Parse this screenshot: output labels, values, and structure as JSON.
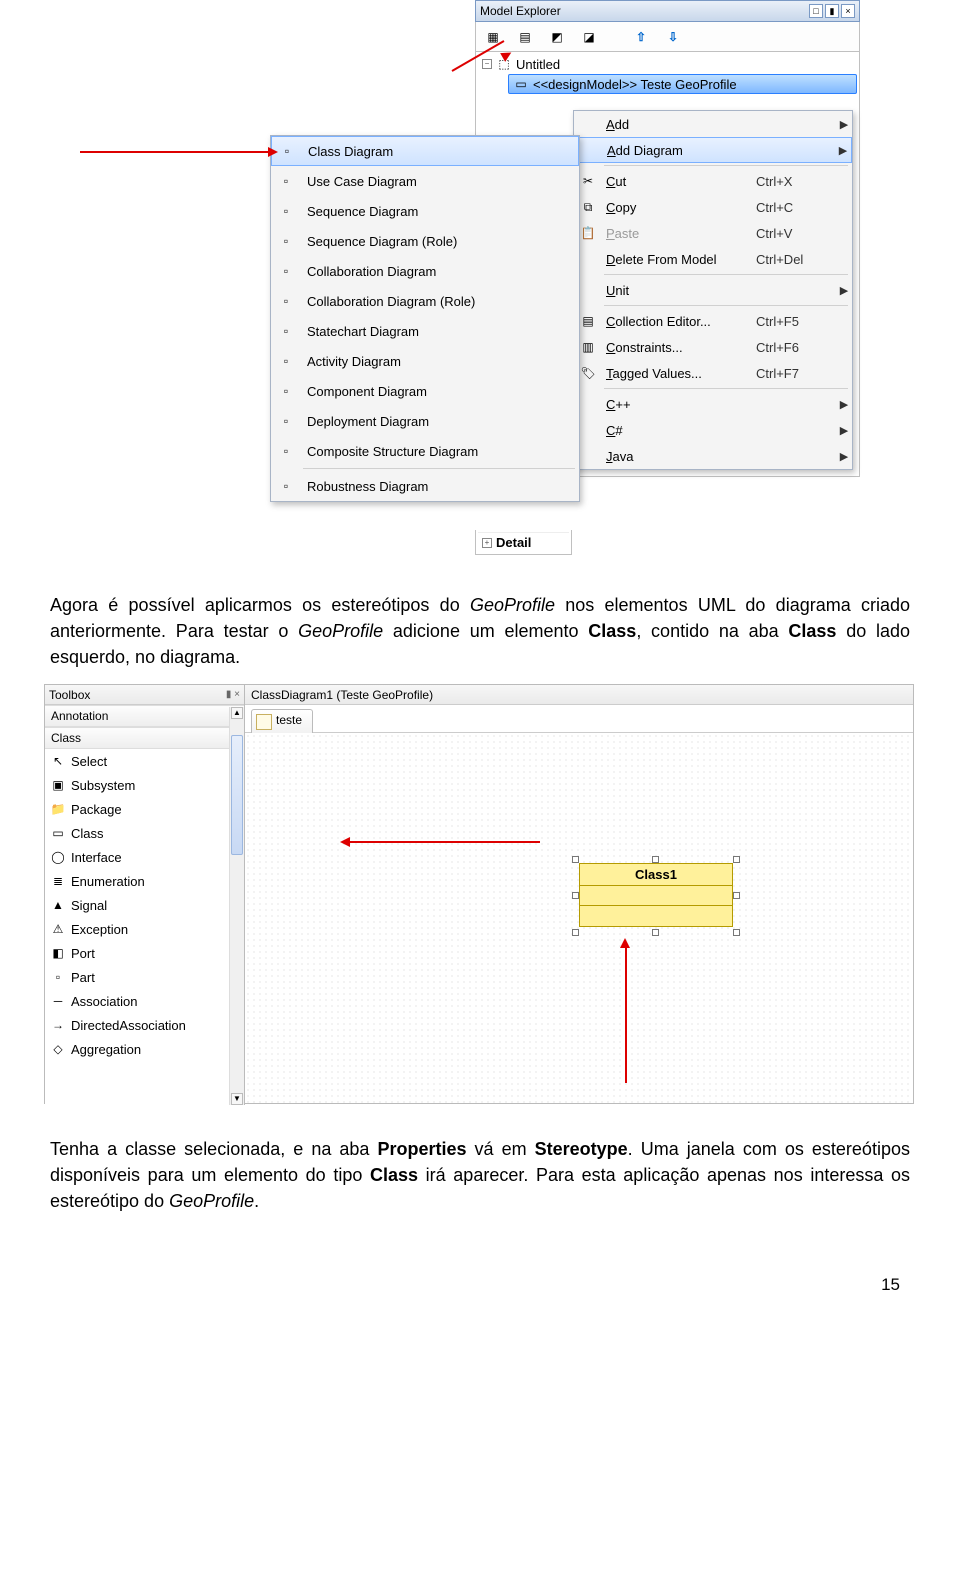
{
  "explorer": {
    "title": "Model Explorer",
    "root": "Untitled",
    "selected": "<<designModel>> Teste GeoProfile",
    "detail": "Detail"
  },
  "context_menu": [
    {
      "label": "Add",
      "arrow": true
    },
    {
      "label": "Add Diagram",
      "arrow": true,
      "selected": true
    },
    {
      "sep": true
    },
    {
      "icon": "cut-icon",
      "label": "Cut",
      "shortcut": "Ctrl+X"
    },
    {
      "icon": "copy-icon",
      "label": "Copy",
      "shortcut": "Ctrl+C"
    },
    {
      "icon": "paste-icon",
      "label": "Paste",
      "shortcut": "Ctrl+V",
      "disabled": true
    },
    {
      "label": "Delete From Model",
      "shortcut": "Ctrl+Del"
    },
    {
      "sep": true
    },
    {
      "label": "Unit",
      "arrow": true
    },
    {
      "sep": true
    },
    {
      "icon": "collection-icon",
      "label": "Collection Editor...",
      "shortcut": "Ctrl+F5"
    },
    {
      "icon": "constraints-icon",
      "label": "Constraints...",
      "shortcut": "Ctrl+F6"
    },
    {
      "icon": "tagged-icon",
      "label": "Tagged Values...",
      "shortcut": "Ctrl+F7"
    },
    {
      "sep": true
    },
    {
      "label": "C++",
      "arrow": true
    },
    {
      "label": "C#",
      "arrow": true
    },
    {
      "label": "Java",
      "arrow": true
    }
  ],
  "submenu": [
    {
      "label": "Class Diagram",
      "selected": true,
      "icon": "class-diagram-icon"
    },
    {
      "label": "Use Case Diagram",
      "icon": "usecase-diagram-icon"
    },
    {
      "label": "Sequence Diagram",
      "icon": "sequence-diagram-icon"
    },
    {
      "label": "Sequence Diagram (Role)",
      "icon": "sequence-role-diagram-icon"
    },
    {
      "label": "Collaboration Diagram",
      "icon": "collab-diagram-icon"
    },
    {
      "label": "Collaboration Diagram (Role)",
      "icon": "collab-role-diagram-icon"
    },
    {
      "label": "Statechart Diagram",
      "icon": "statechart-diagram-icon"
    },
    {
      "label": "Activity Diagram",
      "icon": "activity-diagram-icon"
    },
    {
      "label": "Component Diagram",
      "icon": "component-diagram-icon"
    },
    {
      "label": "Deployment Diagram",
      "icon": "deployment-diagram-icon"
    },
    {
      "label": "Composite Structure Diagram",
      "icon": "composite-diagram-icon"
    },
    {
      "sep": true
    },
    {
      "label": "Robustness Diagram",
      "icon": "robustness-diagram-icon"
    }
  ],
  "doc": {
    "p1a": "Agora é possível aplicarmos os estereótipos do ",
    "p1b": " nos elementos UML do diagrama criado anteriormente. Para testar o ",
    "p1c": " adicione um elemento ",
    "p1d": ", contido na aba ",
    "p1e": " do lado esquerdo, no diagrama.",
    "geo": "GeoProfile",
    "class": "Class",
    "p2a": "Tenha a classe selecionada, e na aba ",
    "p2b": " vá em ",
    "p2c": ". Uma janela com os estereótipos disponíveis para um elemento do tipo ",
    "p2d": " irá aparecer. Para esta aplicação apenas nos interessa os estereótipo do ",
    "p2e": ".",
    "properties": "Properties",
    "stereotype": "Stereotype"
  },
  "toolbox": {
    "title": "Toolbox",
    "group1": "Annotation",
    "group2": "Class",
    "items": [
      {
        "label": "Select",
        "icon": "cursor-icon"
      },
      {
        "label": "Subsystem",
        "icon": "subsystem-icon"
      },
      {
        "label": "Package",
        "icon": "package-icon"
      },
      {
        "label": "Class",
        "icon": "class-icon"
      },
      {
        "label": "Interface",
        "icon": "interface-icon"
      },
      {
        "label": "Enumeration",
        "icon": "enum-icon"
      },
      {
        "label": "Signal",
        "icon": "signal-icon"
      },
      {
        "label": "Exception",
        "icon": "exception-icon"
      },
      {
        "label": "Port",
        "icon": "port-icon"
      },
      {
        "label": "Part",
        "icon": "part-icon"
      },
      {
        "label": "Association",
        "icon": "assoc-icon"
      },
      {
        "label": "DirectedAssociation",
        "icon": "diassoc-icon"
      },
      {
        "label": "Aggregation",
        "icon": "aggr-icon"
      }
    ]
  },
  "canvas": {
    "header": "ClassDiagram1 (Teste GeoProfile)",
    "tab": "teste",
    "classname": "Class1"
  },
  "page": "15"
}
